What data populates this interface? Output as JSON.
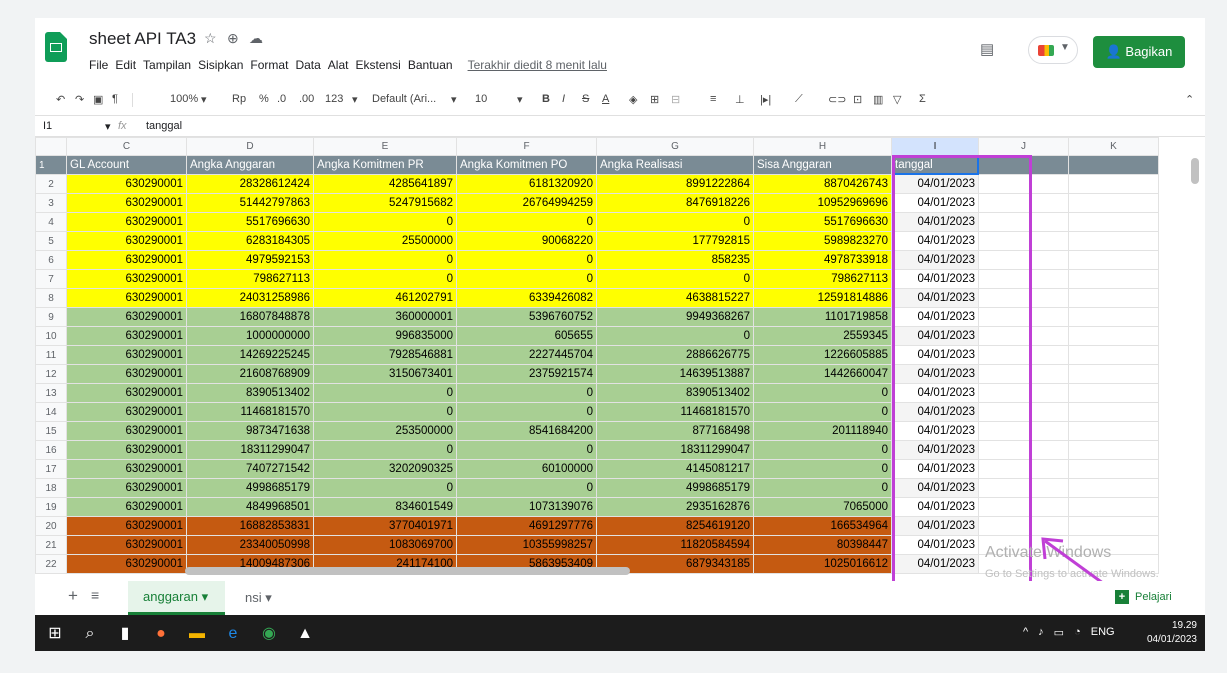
{
  "app": {
    "doc_title": "sheet API TA3",
    "last_edit": "Terakhir diedit 8 menit lalu",
    "share_label": "Bagikan"
  },
  "menu": [
    "File",
    "Edit",
    "Tampilan",
    "Sisipkan",
    "Format",
    "Data",
    "Alat",
    "Ekstensi",
    "Bantuan"
  ],
  "toolbar": {
    "zoom": "100%",
    "currency": "Rp",
    "percent": "%",
    "dec_less": ".0",
    "dec_more": ".00",
    "fmt": "123",
    "font": "Default (Ari...",
    "size": "10"
  },
  "formula": {
    "cell_ref": "I1",
    "fx": "fx",
    "value": "tanggal"
  },
  "columns": [
    "C",
    "D",
    "E",
    "F",
    "G",
    "H",
    "I",
    "J",
    "K"
  ],
  "header_row": {
    "row": "1",
    "cells": [
      "GL Account",
      "Angka Anggaran",
      "Angka Komitmen PR",
      "Angka Komitmen PO",
      "Angka Realisasi",
      "Sisa Anggaran",
      "tanggal"
    ]
  },
  "rows": [
    {
      "n": "2",
      "c": "y",
      "v": [
        "630290001",
        "28328612424",
        "4285641897",
        "6181320920",
        "8991222864",
        "8870426743",
        "04/01/2023"
      ]
    },
    {
      "n": "3",
      "c": "y",
      "v": [
        "630290001",
        "51442797863",
        "5247915682",
        "26764994259",
        "8476918226",
        "10952969696",
        "04/01/2023"
      ]
    },
    {
      "n": "4",
      "c": "y",
      "v": [
        "630290001",
        "5517696630",
        "0",
        "0",
        "0",
        "5517696630",
        "04/01/2023"
      ]
    },
    {
      "n": "5",
      "c": "y",
      "v": [
        "630290001",
        "6283184305",
        "25500000",
        "90068220",
        "177792815",
        "5989823270",
        "04/01/2023"
      ]
    },
    {
      "n": "6",
      "c": "y",
      "v": [
        "630290001",
        "4979592153",
        "0",
        "0",
        "858235",
        "4978733918",
        "04/01/2023"
      ]
    },
    {
      "n": "7",
      "c": "y",
      "v": [
        "630290001",
        "798627113",
        "0",
        "0",
        "0",
        "798627113",
        "04/01/2023"
      ]
    },
    {
      "n": "8",
      "c": "y",
      "v": [
        "630290001",
        "24031258986",
        "461202791",
        "6339426082",
        "4638815227",
        "12591814886",
        "04/01/2023"
      ]
    },
    {
      "n": "9",
      "c": "g",
      "v": [
        "630290001",
        "16807848878",
        "360000001",
        "5396760752",
        "9949368267",
        "1101719858",
        "04/01/2023"
      ]
    },
    {
      "n": "10",
      "c": "g",
      "v": [
        "630290001",
        "1000000000",
        "996835000",
        "605655",
        "0",
        "2559345",
        "04/01/2023"
      ]
    },
    {
      "n": "11",
      "c": "g",
      "v": [
        "630290001",
        "14269225245",
        "7928546881",
        "2227445704",
        "2886626775",
        "1226605885",
        "04/01/2023"
      ]
    },
    {
      "n": "12",
      "c": "g",
      "v": [
        "630290001",
        "21608768909",
        "3150673401",
        "2375921574",
        "14639513887",
        "1442660047",
        "04/01/2023"
      ]
    },
    {
      "n": "13",
      "c": "g",
      "v": [
        "630290001",
        "8390513402",
        "0",
        "0",
        "8390513402",
        "0",
        "04/01/2023"
      ]
    },
    {
      "n": "14",
      "c": "g",
      "v": [
        "630290001",
        "11468181570",
        "0",
        "0",
        "11468181570",
        "0",
        "04/01/2023"
      ]
    },
    {
      "n": "15",
      "c": "g",
      "v": [
        "630290001",
        "9873471638",
        "253500000",
        "8541684200",
        "877168498",
        "201118940",
        "04/01/2023"
      ]
    },
    {
      "n": "16",
      "c": "g",
      "v": [
        "630290001",
        "18311299047",
        "0",
        "0",
        "18311299047",
        "0",
        "04/01/2023"
      ]
    },
    {
      "n": "17",
      "c": "g",
      "v": [
        "630290001",
        "7407271542",
        "3202090325",
        "60100000",
        "4145081217",
        "0",
        "04/01/2023"
      ]
    },
    {
      "n": "18",
      "c": "g",
      "v": [
        "630290001",
        "4998685179",
        "0",
        "0",
        "4998685179",
        "0",
        "04/01/2023"
      ]
    },
    {
      "n": "19",
      "c": "g",
      "v": [
        "630290001",
        "4849968501",
        "834601549",
        "1073139076",
        "2935162876",
        "7065000",
        "04/01/2023"
      ]
    },
    {
      "n": "20",
      "c": "o",
      "v": [
        "630290001",
        "16882853831",
        "3770401971",
        "4691297776",
        "8254619120",
        "166534964",
        "04/01/2023"
      ]
    },
    {
      "n": "21",
      "c": "o",
      "v": [
        "630290001",
        "23340050998",
        "1083069700",
        "10355998257",
        "11820584594",
        "80398447",
        "04/01/2023"
      ]
    },
    {
      "n": "22",
      "c": "o",
      "v": [
        "630290001",
        "14009487306",
        "241174100",
        "5863953409",
        "6879343185",
        "1025016612",
        "04/01/2023"
      ]
    }
  ],
  "sheet_tabs": {
    "active": "anggaran",
    "other": "nsi",
    "pelajari": "Pelajari"
  },
  "watermark": {
    "line1": "Activate Windows",
    "line2": "Go to Settings to activate Windows."
  },
  "taskbar": {
    "time": "19.29",
    "date": "04/01/2023",
    "lang": "ENG"
  },
  "colors": {
    "yellow": "#ffff00",
    "green": "#a8cf93",
    "orange": "#c55a11",
    "highlight": "#c03fd6"
  }
}
